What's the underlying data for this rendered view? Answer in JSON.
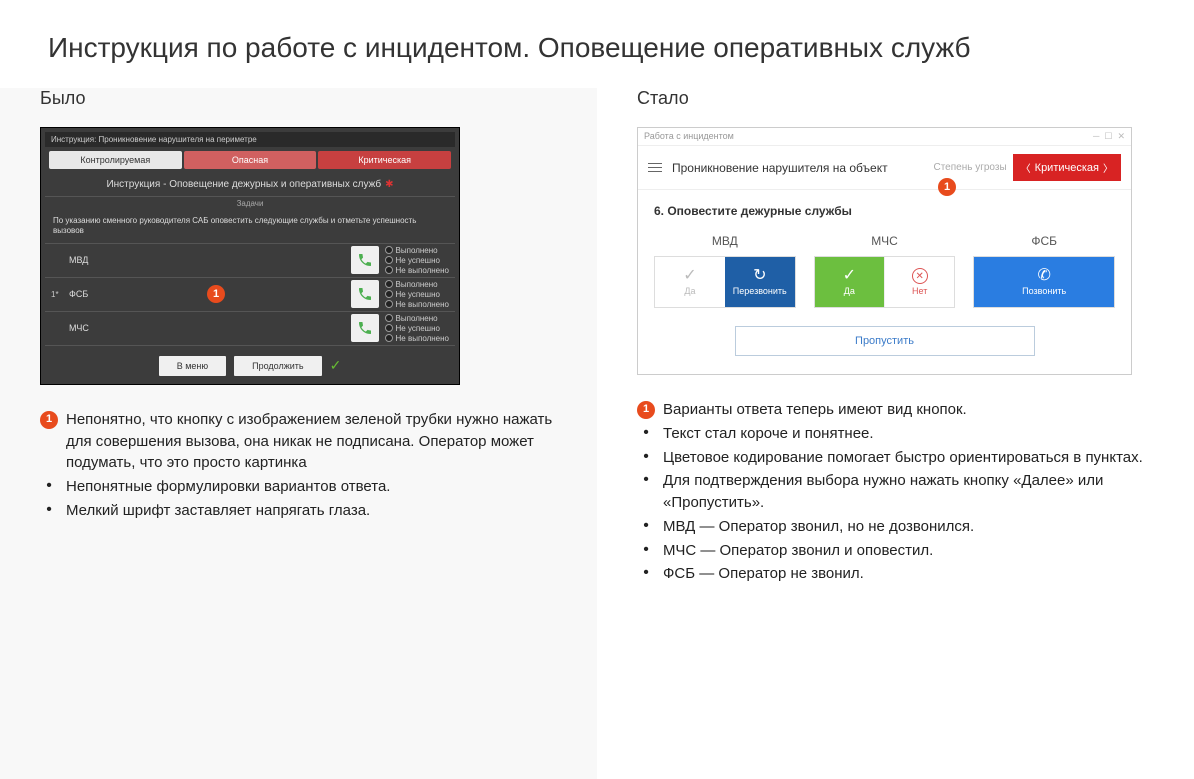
{
  "title": "Инструкция по работе с инцидентом. Оповещение оперативных служб",
  "left": {
    "heading": "Было",
    "app": {
      "windowTitle": "Инструкция: Проникновение нарушителя на периметре",
      "tabs": {
        "a": "Контролируемая",
        "b": "Опасная",
        "c": "Критическая"
      },
      "subtitle": "Инструкция - Оповещение дежурных и оперативных служб",
      "tasksLabel": "Задачи",
      "instruction": "По указанию сменного руководителя САБ оповестить следующие службы и отметьте успешность вызовов",
      "numLabel": "1*",
      "services": {
        "a": "МВД",
        "b": "ФСБ",
        "c": "МЧС"
      },
      "options": {
        "a": "Выполнено",
        "b": "Не успешно",
        "c": "Не выполнено"
      },
      "footer": {
        "menu": "В меню",
        "cont": "Продолжить"
      }
    },
    "notes": [
      {
        "marker": "1",
        "text": "Непонятно, что кнопку с изображением зеленой трубки нужно нажать для совершения вызова, она никак не подписана. Оператор может подумать, что это просто картинка"
      },
      {
        "marker": "dot",
        "text": "Непонятные формулировки вариантов ответа."
      },
      {
        "marker": "dot",
        "text": "Мелкий шрифт заставляет напрягать глаза."
      }
    ]
  },
  "right": {
    "heading": "Стало",
    "app": {
      "windowTitle": "Работа с инцидентом",
      "headerTitle": "Проникновение нарушителя на объект",
      "threatLabel": "Степень угрозы",
      "critBadge": "Критическая",
      "stepTitle": "6. Оповестите дежурные службы",
      "services": {
        "mvd": {
          "name": "МВД",
          "a": "Да",
          "b": "Перезвонить"
        },
        "mchs": {
          "name": "МЧС",
          "a": "Да",
          "b": "Нет"
        },
        "fsb": {
          "name": "ФСБ",
          "a": "Позвонить"
        }
      },
      "skip": "Пропустить"
    },
    "notes": [
      {
        "marker": "1",
        "text": "Варианты ответа теперь имеют вид кнопок."
      },
      {
        "marker": "dot",
        "text": "Текст стал короче и понятнее."
      },
      {
        "marker": "dot",
        "text": "Цветовое кодирование помогает быстро ориентироваться в пунктах."
      },
      {
        "marker": "dot",
        "text": "Для подтверждения выбора нужно нажать кнопку «Далее» или «Пропустить»."
      },
      {
        "marker": "dot",
        "text": "МВД — Оператор звонил, но не дозвонился."
      },
      {
        "marker": "dot",
        "text": "МЧС — Оператор звонил и оповестил."
      },
      {
        "marker": "dot",
        "text": "ФСБ — Оператор не звонил."
      }
    ]
  },
  "markerDigit": "1"
}
